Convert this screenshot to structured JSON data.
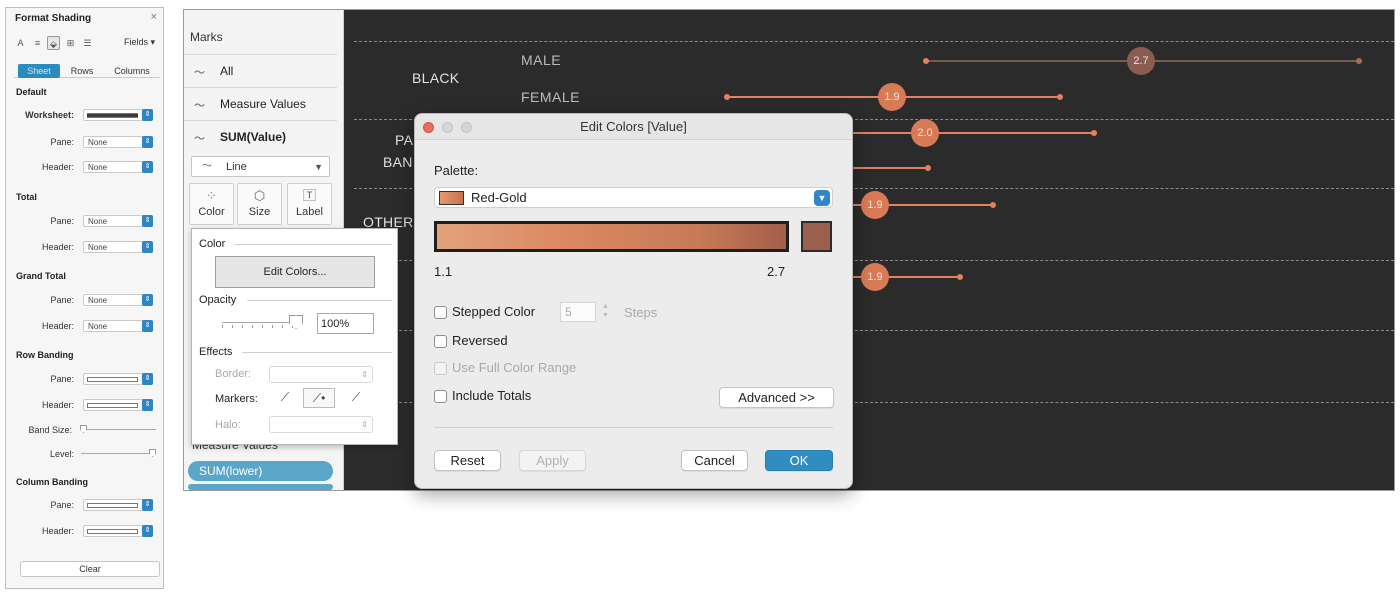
{
  "format_shading": {
    "title": "Format Shading",
    "close": "×",
    "toolbar_icons": [
      "font-icon",
      "align-icon",
      "shading-icon",
      "borders-icon",
      "lines-icon"
    ],
    "fields_label": "Fields ▾",
    "tabs": [
      "Sheet",
      "Rows",
      "Columns"
    ],
    "active_tab": "Sheet",
    "sections": {
      "default": {
        "title": "Default",
        "worksheet_label": "Worksheet:",
        "pane_label": "Pane:",
        "pane_value": "None",
        "header_label": "Header:",
        "header_value": "None"
      },
      "total": {
        "title": "Total",
        "pane_label": "Pane:",
        "pane_value": "None",
        "header_label": "Header:",
        "header_value": "None"
      },
      "grand_total": {
        "title": "Grand Total",
        "pane_label": "Pane:",
        "pane_value": "None",
        "header_label": "Header:",
        "header_value": "None"
      },
      "row_banding": {
        "title": "Row Banding",
        "pane_label": "Pane:",
        "header_label": "Header:",
        "band_size_label": "Band Size:",
        "level_label": "Level:"
      },
      "column_banding": {
        "title": "Column Banding",
        "pane_label": "Pane:",
        "header_label": "Header:"
      }
    },
    "clear_label": "Clear"
  },
  "marks": {
    "title": "Marks",
    "rows": [
      "All",
      "Measure Values",
      "SUM(Value)"
    ],
    "mark_type": "Line",
    "buttons": [
      "Color",
      "Size",
      "Label"
    ],
    "measure_values_label": "Measure Values",
    "pills": [
      "SUM(lower)",
      ""
    ]
  },
  "chart": {
    "categories": [
      "BLACK",
      "PA",
      "BAN",
      "OTHER"
    ],
    "subcategories": [
      "MALE",
      "FEMALE"
    ],
    "bubble_values": [
      "2.7",
      "1.9",
      "2.0",
      "1.9",
      "1.9"
    ]
  },
  "color_popup": {
    "color_label": "Color",
    "edit_colors_label": "Edit Colors...",
    "opacity_label": "Opacity",
    "opacity_value": "100%",
    "effects_label": "Effects",
    "border_label": "Border:",
    "markers_label": "Markers:",
    "halo_label": "Halo:"
  },
  "edit_colors": {
    "title": "Edit Colors [Value]",
    "palette_label": "Palette:",
    "palette_value": "Red-Gold",
    "range_min": "1.1",
    "range_max": "2.7",
    "stepped_color_label": "Stepped Color",
    "steps_value": "5",
    "steps_label": "Steps",
    "reversed_label": "Reversed",
    "full_range_label": "Use Full Color Range",
    "include_totals_label": "Include Totals",
    "advanced_label": "Advanced >>",
    "reset_label": "Reset",
    "apply_label": "Apply",
    "cancel_label": "Cancel",
    "ok_label": "OK"
  },
  "colors": {
    "accent": "#2f8dc2",
    "chart_bg": "#2c2b2b",
    "mark_orange": "#e0825f",
    "mark_dark": "#9b5f4e"
  }
}
